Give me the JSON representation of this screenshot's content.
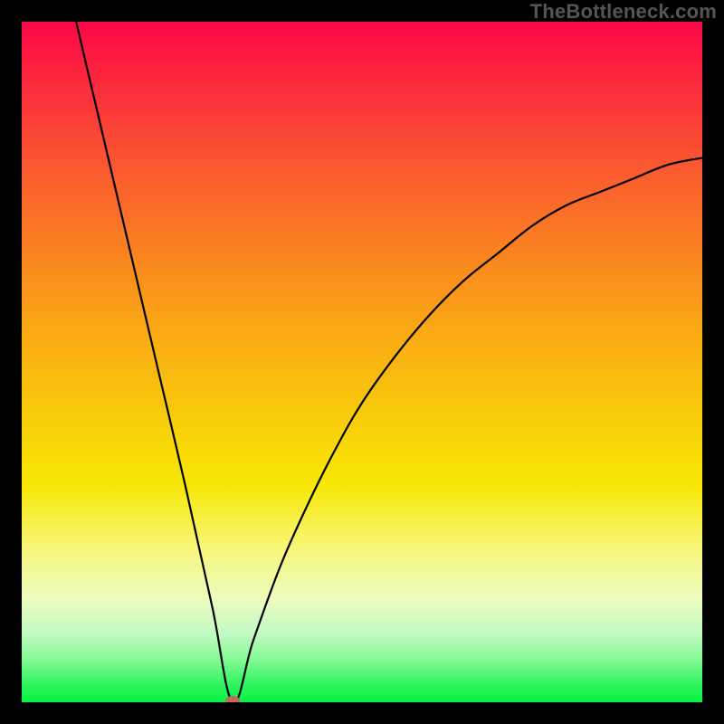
{
  "watermark": "TheBottleneck.com",
  "chart_data": {
    "type": "line",
    "title": "",
    "xlabel": "",
    "ylabel": "",
    "xlim": [
      0,
      100
    ],
    "ylim": [
      0,
      100
    ],
    "annotations": [],
    "curve": {
      "description": "V-shaped curve with minimum at x≈31. Left branch is steep and nearly linear from (8,100) down to (31,0). Right branch rises from (31,0) along a concave-down curve approaching ~80 at x=100.",
      "min_x": 31,
      "min_y": 0,
      "points": [
        {
          "x": 8,
          "y": 100
        },
        {
          "x": 12,
          "y": 83
        },
        {
          "x": 16,
          "y": 66
        },
        {
          "x": 20,
          "y": 49
        },
        {
          "x": 24,
          "y": 32
        },
        {
          "x": 28,
          "y": 14
        },
        {
          "x": 31,
          "y": 0
        },
        {
          "x": 34,
          "y": 9
        },
        {
          "x": 38,
          "y": 20
        },
        {
          "x": 42,
          "y": 29
        },
        {
          "x": 46,
          "y": 37
        },
        {
          "x": 50,
          "y": 44
        },
        {
          "x": 55,
          "y": 51
        },
        {
          "x": 60,
          "y": 57
        },
        {
          "x": 65,
          "y": 62
        },
        {
          "x": 70,
          "y": 66
        },
        {
          "x": 75,
          "y": 70
        },
        {
          "x": 80,
          "y": 73
        },
        {
          "x": 85,
          "y": 75
        },
        {
          "x": 90,
          "y": 77
        },
        {
          "x": 95,
          "y": 79
        },
        {
          "x": 100,
          "y": 80
        }
      ]
    },
    "marker": {
      "x": 31,
      "y": 0,
      "color": "#c0695f"
    },
    "background_gradient": {
      "type": "vertical",
      "stops": [
        {
          "pos": 0.0,
          "color": "#fb0846"
        },
        {
          "pos": 0.22,
          "color": "#fb5b2f"
        },
        {
          "pos": 0.45,
          "color": "#faa814"
        },
        {
          "pos": 0.68,
          "color": "#f7e704"
        },
        {
          "pos": 0.78,
          "color": "#f7f781"
        },
        {
          "pos": 0.85,
          "color": "#ecfbc0"
        },
        {
          "pos": 0.9,
          "color": "#c1fbc2"
        },
        {
          "pos": 0.94,
          "color": "#7ef991"
        },
        {
          "pos": 0.97,
          "color": "#37f563"
        },
        {
          "pos": 1.0,
          "color": "#05f243"
        }
      ]
    }
  }
}
